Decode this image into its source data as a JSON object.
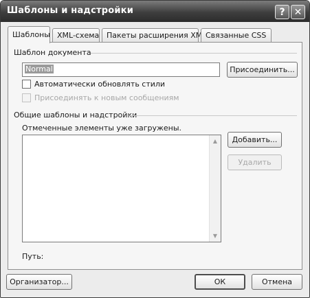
{
  "window": {
    "title": "Шаблоны и надстройки",
    "help_glyph": "?",
    "close_glyph": "✕"
  },
  "tabs": [
    {
      "label": "Шаблоны",
      "active": true
    },
    {
      "label": "XML-схема",
      "active": false
    },
    {
      "label": "Пакеты расширения XML",
      "active": false
    },
    {
      "label": "Связанные CSS",
      "active": false
    }
  ],
  "document_template": {
    "group_label": "Шаблон документа",
    "template_value": "Normal",
    "attach_button": "Присоединить...",
    "auto_update_label": "Автоматически обновлять стили",
    "auto_update_checked": false,
    "attach_to_new_label": "Присоединять к новым сообщениям",
    "attach_to_new_enabled": false
  },
  "global_templates": {
    "group_label": "Общие шаблоны и надстройки",
    "hint": "Отмеченные элементы уже загружены.",
    "items": [],
    "add_button": "Добавить...",
    "remove_button": "Удалить",
    "path_label": "Путь:"
  },
  "footer": {
    "organizer_button": "Организатор...",
    "ok_button": "ОК",
    "cancel_button": "Отмена"
  },
  "icons": {
    "scroll_up": "up-arrow-icon",
    "scroll_down": "down-arrow-icon"
  }
}
